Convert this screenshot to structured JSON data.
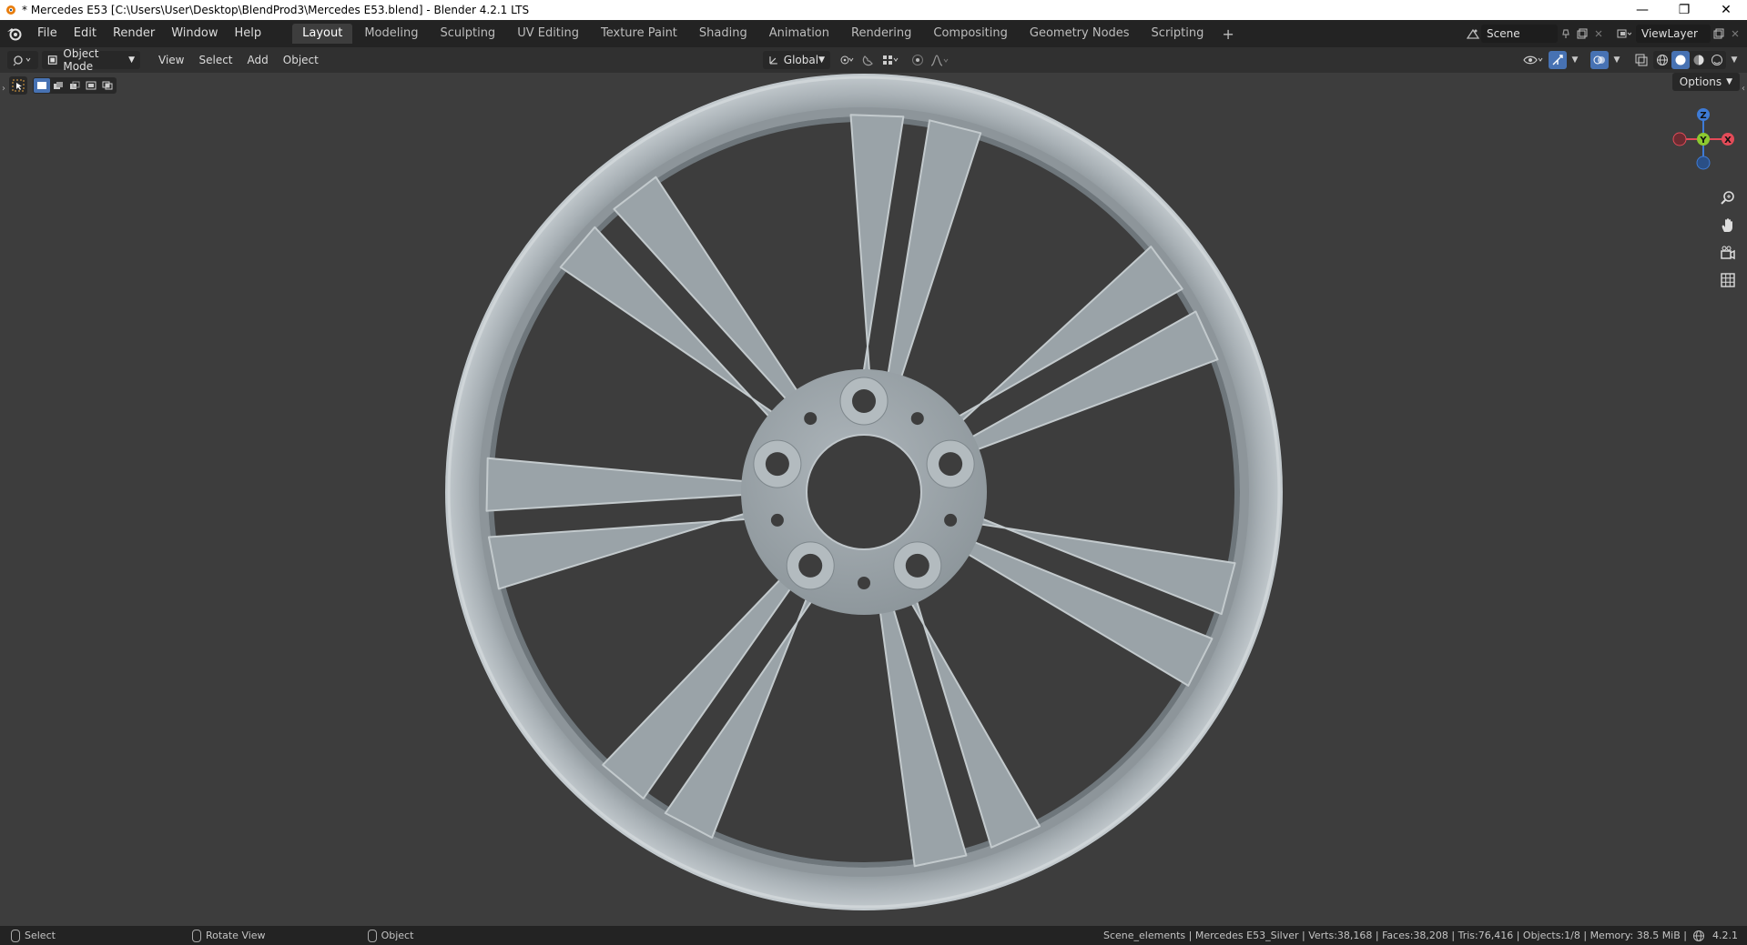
{
  "window": {
    "title": "* Mercedes E53 [C:\\Users\\User\\Desktop\\BlendProd3\\Mercedes E53.blend] - Blender 4.2.1 LTS",
    "minimize_glyph": "—",
    "restore_glyph": "❐",
    "close_glyph": "✕"
  },
  "menu": [
    "File",
    "Edit",
    "Render",
    "Window",
    "Help"
  ],
  "workspaces": {
    "tabs": [
      "Layout",
      "Modeling",
      "Sculpting",
      "UV Editing",
      "Texture Paint",
      "Shading",
      "Animation",
      "Rendering",
      "Compositing",
      "Geometry Nodes",
      "Scripting"
    ],
    "active": "Layout",
    "add_glyph": "+"
  },
  "scene": {
    "name": "Scene",
    "view_layer": "ViewLayer"
  },
  "viewport_header": {
    "mode": "Object Mode",
    "menus": [
      "View",
      "Select",
      "Add",
      "Object"
    ],
    "transform_orientation": "Global",
    "options_label": "Options"
  },
  "gizmo": {
    "z": "Z",
    "y": "Y",
    "x": "X"
  },
  "status": {
    "hints": [
      "Select",
      "Rotate View",
      "Object"
    ],
    "stats": "Scene_elements | Mercedes E53_Silver | Verts:38,168 | Faces:38,208 | Tris:76,416 | Objects:1/8 | Memory: 38.5 MiB |",
    "version": "4.2.1"
  },
  "colors": {
    "accent": "#4772b3",
    "axis_x": "#e34b58",
    "axis_y": "#8cc930",
    "axis_z": "#3e7bd6",
    "wheel": "#a4adb2"
  },
  "icons": {
    "app": "blender-logo-icon",
    "zoom": "zoom-icon",
    "pan": "hand-pan-icon",
    "camera": "camera-icon",
    "ortho": "grid-ortho-icon"
  }
}
